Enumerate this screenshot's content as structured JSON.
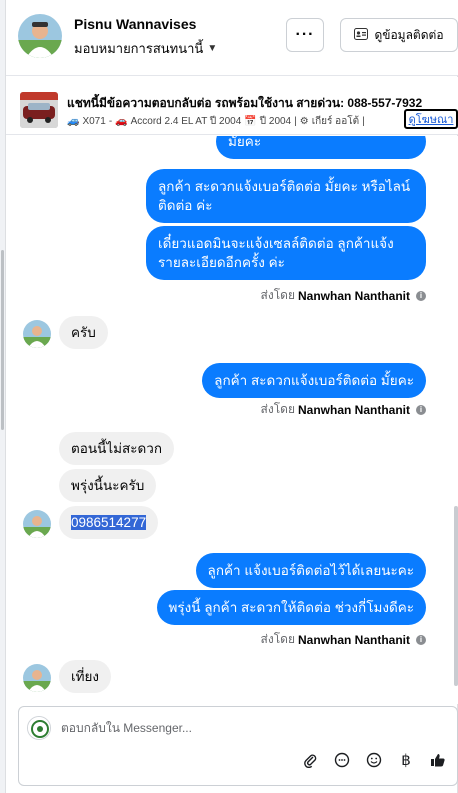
{
  "header": {
    "name": "Pisnu Wannavises",
    "assign_label": "มอบหมายการสนทนานี้",
    "more_label": "···",
    "contact_label": "ดูข้อมูลติดต่อ"
  },
  "listing": {
    "title": "แชทนี้มีข้อความตอบกลับต่อ รถพร้อมใช้งาน สายด่วน: 088-557-7932",
    "code": "X071",
    "model": "Accord 2.4 EL AT ปี 2004",
    "year": "ปี 2004",
    "gear": "เกียร์ ออโต้",
    "link_label": "ดูโฆษณา"
  },
  "messages": {
    "m1": "มั้ยคะ",
    "m2": "ลูกค้า สะดวกแจ้งเบอร์ติดต่อ มั้ยคะ  หรือไลน์ติดต่อ ค่ะ",
    "m3": "เดี๋ยวแอดมินจะแจ้งเซลล์ติดต่อ ลูกค้าแจ้งรายละเอียดอีกครั้ง ค่ะ",
    "sent_prefix": "ส่งโดย",
    "sender": "Nanwhan Nanthanit",
    "m4": "ครับ",
    "m5": "ลูกค้า สะดวกแจ้งเบอร์ติดต่อ มั้ยคะ",
    "m6": "ตอนนี้ไม่สะดวก",
    "m7": "พรุ่งนี้นะครับ",
    "m8": "0986514277",
    "m9": "ลูกค้า แจ้งเบอร์ติดต่อไว้ได้เลยนะคะ",
    "m10": "พรุ่งนี้ ลูกค้า สะดวกให้ติดต่อ ช่วงกี่โมงดีคะ",
    "m11": "เที่ยง"
  },
  "composer": {
    "placeholder": "ตอบกลับใน Messenger..."
  },
  "colors": {
    "outgoing_bubble": "#0a7cff",
    "incoming_bubble": "#f0f0f0",
    "selection_highlight": "#3367d6"
  },
  "icons": [
    "chevron-down-icon",
    "contact-card-icon",
    "car-icon",
    "calendar-icon",
    "gear-icon",
    "info-icon",
    "attach-icon",
    "message-icon",
    "emoji-icon",
    "baht-icon",
    "thumbs-up-icon"
  ]
}
